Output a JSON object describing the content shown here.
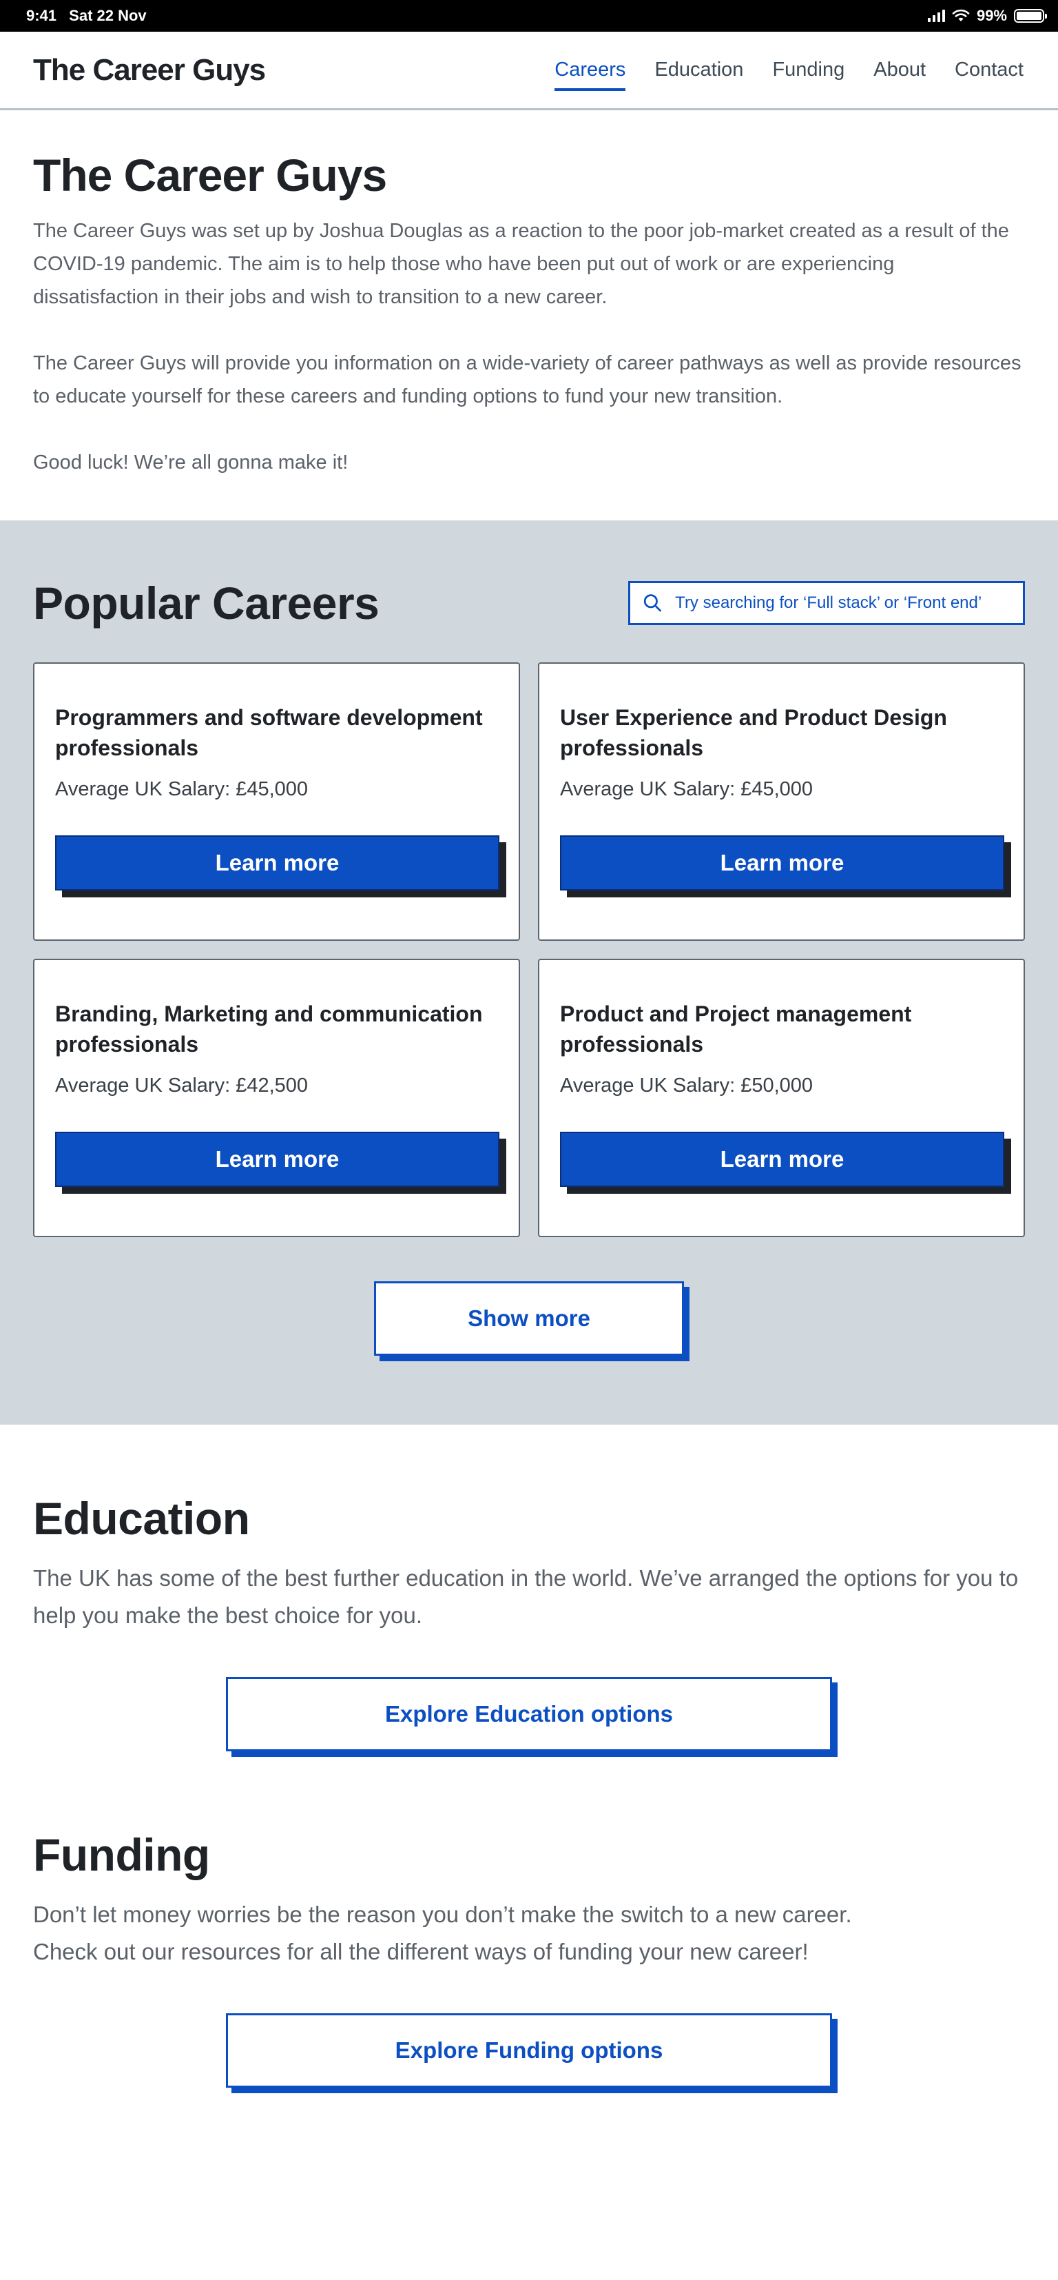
{
  "status_bar": {
    "time": "9:41",
    "date": "Sat 22 Nov",
    "battery": "99%",
    "battery_level": 0.99
  },
  "nav": {
    "logo": "The Career Guys",
    "links": [
      {
        "label": "Careers",
        "active": true
      },
      {
        "label": "Education",
        "active": false
      },
      {
        "label": "Funding",
        "active": false
      },
      {
        "label": "About",
        "active": false
      },
      {
        "label": "Contact",
        "active": false
      }
    ]
  },
  "intro": {
    "title": "The Career Guys",
    "paragraphs": [
      "The Career Guys was set up by Joshua Douglas as a reaction to the poor job-market created as a result of the COVID-19 pandemic. The aim is to help those who have been put out of work or are experiencing dissatisfaction in their jobs and wish to transition to a new career.",
      "The Career Guys will provide you information on a wide-variety of career pathways as well as provide resources to educate yourself for these careers and funding options to fund your new transition.",
      "Good luck! We’re all gonna make it!"
    ]
  },
  "careers": {
    "title": "Popular Careers",
    "search_placeholder": "Try searching for ‘Full stack’ or ‘Front end’",
    "cards": [
      {
        "title": "Programmers and software development professionals",
        "salary": "Average UK Salary: £45,000",
        "button": "Learn more"
      },
      {
        "title": "User Experience and Product Design professionals",
        "salary": "Average UK Salary: £45,000",
        "button": "Learn more"
      },
      {
        "title": "Branding, Marketing and communication professionals",
        "salary": "Average UK Salary: £42,500",
        "button": "Learn more"
      },
      {
        "title": "Product and Project management professionals",
        "salary": "Average UK Salary: £50,000",
        "button": "Learn more"
      }
    ],
    "show_more": "Show more"
  },
  "education": {
    "title": "Education",
    "text": "The UK has some of the best further education in the world. We’ve arranged the options for you to help you make the best choice for you.",
    "button": "Explore Education options"
  },
  "funding": {
    "title": "Funding",
    "lines": [
      "Don’t let money worries be the reason you don’t make the switch to a new career.",
      "Check out our resources for all the different ways of funding your new career!"
    ],
    "button": "Explore Funding options"
  },
  "colors": {
    "accent": "#0b4fc2",
    "section_bg": "#d0d8de",
    "text": "#1f2328",
    "muted": "#5b6168"
  }
}
